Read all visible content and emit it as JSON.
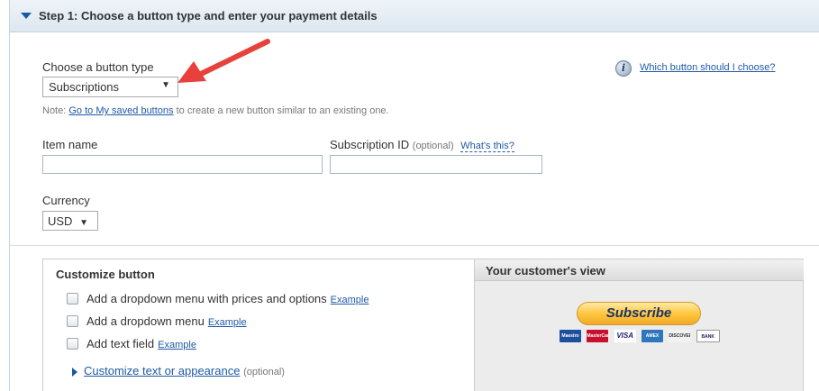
{
  "step": {
    "title": "Step 1: Choose a button type and enter your payment details"
  },
  "button_type": {
    "label": "Choose a button type",
    "selected": "Subscriptions",
    "help_link": "Which button should I choose?",
    "note_prefix": "Note: ",
    "note_link": "Go to My saved buttons",
    "note_suffix": " to create a new button similar to an existing one."
  },
  "item_name": {
    "label": "Item name",
    "value": ""
  },
  "subscription_id": {
    "label": "Subscription ID",
    "optional": "(optional)",
    "help_link": "What's this?",
    "value": ""
  },
  "currency": {
    "label": "Currency",
    "selected": "USD"
  },
  "customize": {
    "title": "Customize button",
    "options": [
      {
        "label": "Add a dropdown menu with prices and options",
        "link": "Example",
        "checked": false
      },
      {
        "label": "Add a dropdown menu",
        "link": "Example",
        "checked": false
      },
      {
        "label": "Add text field",
        "link": "Example",
        "checked": false
      }
    ],
    "expander_label": "Customize text or appearance",
    "expander_optional": "(optional)"
  },
  "preview": {
    "title": "Your customer's view",
    "button_label": "Subscribe",
    "cards": [
      "Maestro",
      "MasterCard",
      "VISA",
      "AMEX",
      "DISCOVER",
      "BANK"
    ]
  },
  "colors": {
    "link": "#1f5aa5",
    "step_arrow": "#1a5aa3",
    "annotation_arrow": "#e8403a",
    "subscribe_button": "#ffc439"
  },
  "icons": {
    "step_toggle": "triangle-down-icon",
    "help": "info-icon",
    "expander": "triangle-right-icon",
    "annotation": "red-arrow-annotation"
  }
}
